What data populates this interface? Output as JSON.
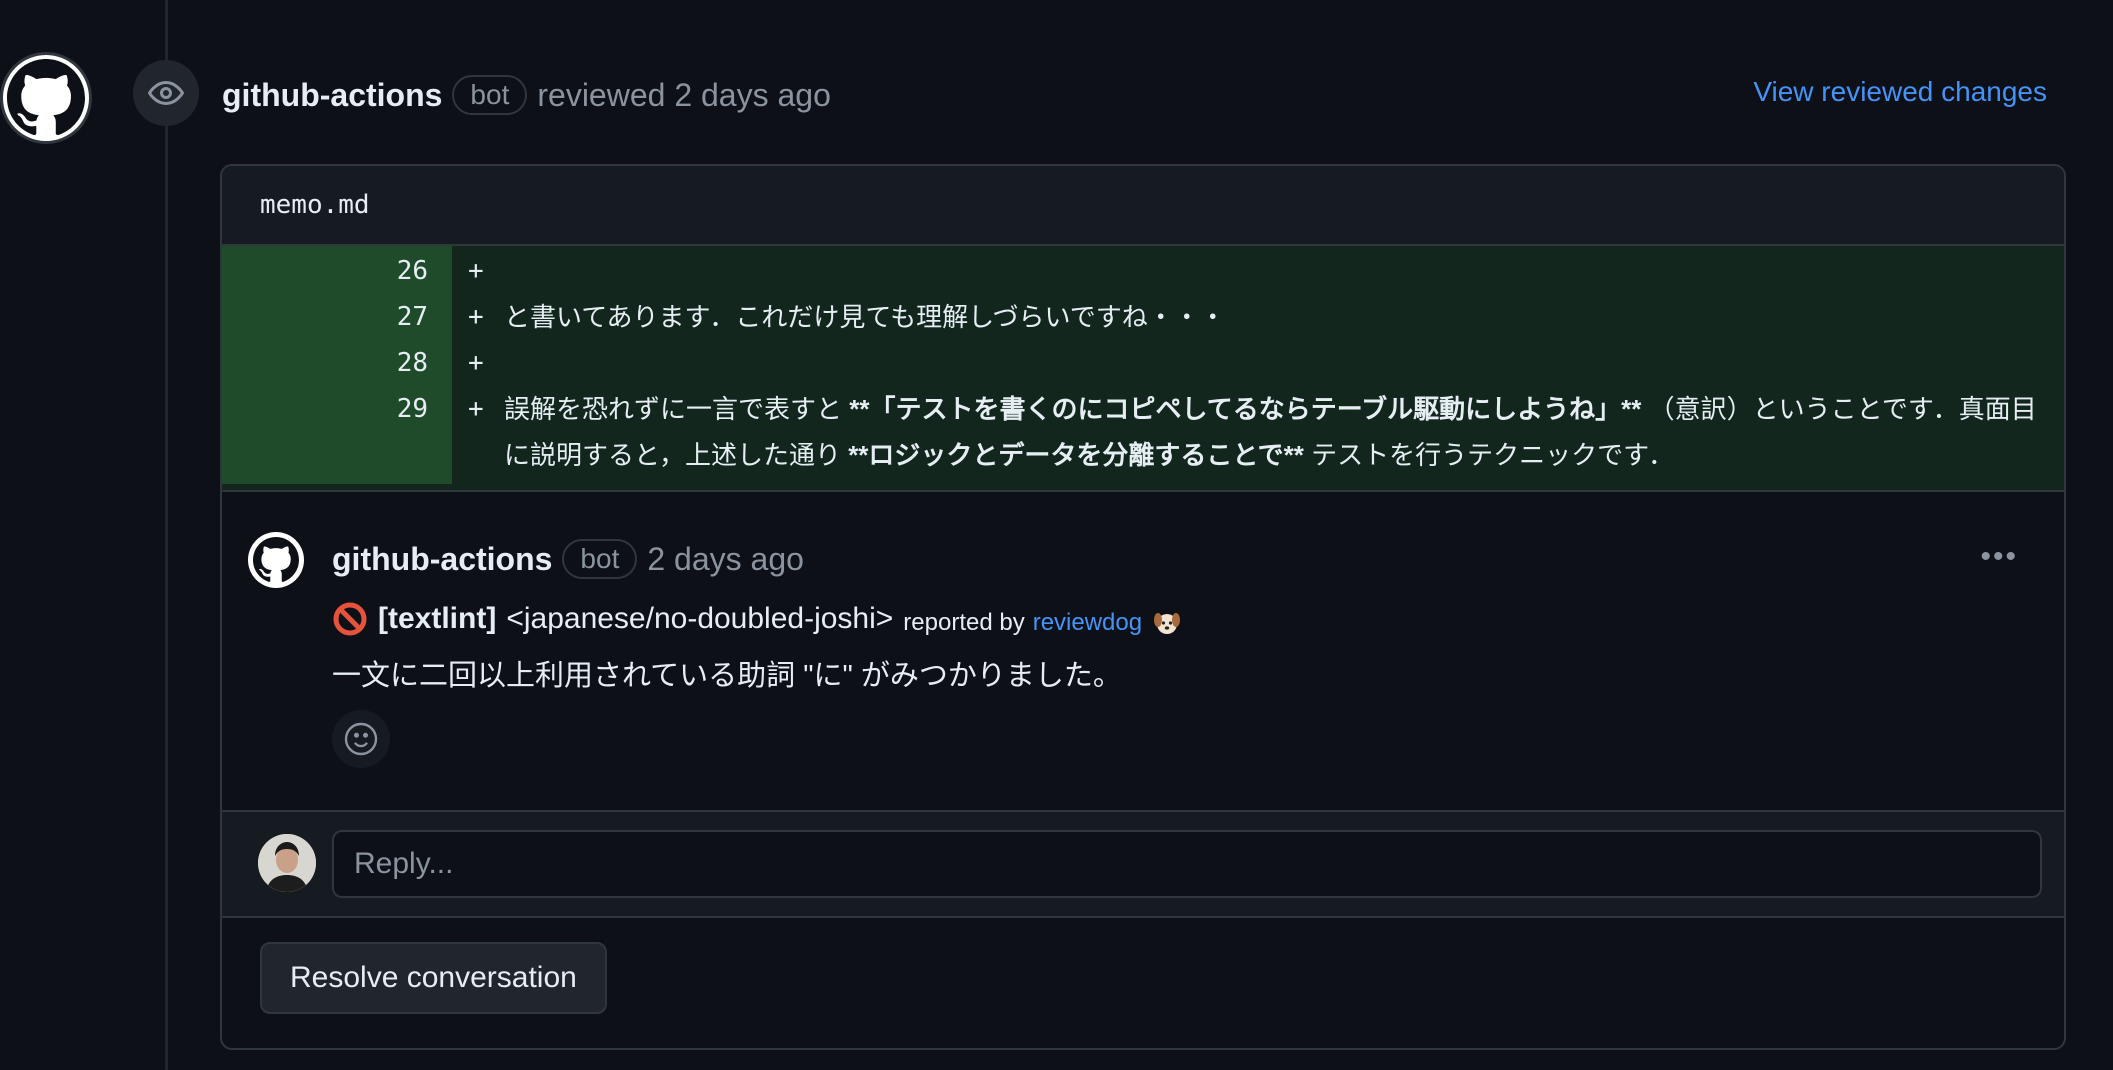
{
  "review": {
    "author": "github-actions",
    "bot_label": "bot",
    "action_text": "reviewed 2 days ago",
    "view_changes_label": "View reviewed changes"
  },
  "thread": {
    "file_name": "memo.md",
    "diff_lines": [
      {
        "num": "26",
        "sign": "+",
        "segments": [
          {
            "text": "",
            "bold": false
          }
        ]
      },
      {
        "num": "27",
        "sign": "+",
        "segments": [
          {
            "text": "と書いてあります．これだけ見ても理解しづらいですね・・・",
            "bold": false
          }
        ]
      },
      {
        "num": "28",
        "sign": "+",
        "segments": [
          {
            "text": "",
            "bold": false
          }
        ]
      },
      {
        "num": "29",
        "sign": "+",
        "segments": [
          {
            "text": "誤解を恐れずに一言で表すと ",
            "bold": false
          },
          {
            "text": "**「テストを書くのにコピペしてるならテーブル駆動にしようね」**",
            "bold": true
          },
          {
            "text": " （意訳）ということです．真面目に説明すると，上述した通り ",
            "bold": false
          },
          {
            "text": "**ロジックとデータを分離することで**",
            "bold": true
          },
          {
            "text": " テストを行うテクニックです．",
            "bold": false
          }
        ]
      }
    ]
  },
  "comment": {
    "author": "github-actions",
    "bot_label": "bot",
    "time": "2 days ago",
    "more_label": "•••",
    "lint_tag": "[textlint]",
    "lint_rule": "<japanese/no-doubled-joshi>",
    "reported_by": "reported by",
    "reporter_link": "reviewdog",
    "message": "一文に二回以上利用されている助詞 \"に\" がみつかりました。"
  },
  "reply": {
    "placeholder": "Reply..."
  },
  "resolve_label": "Resolve conversation",
  "colors": {
    "background": "#0d1117",
    "link": "#4493f8",
    "diff_added_bg": "#12261e",
    "diff_added_num_bg": "#1f4b2b",
    "border": "#30363d"
  }
}
